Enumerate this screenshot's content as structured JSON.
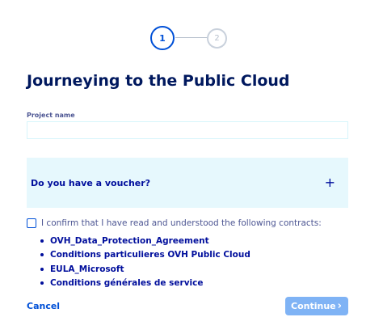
{
  "stepper": {
    "step1": "1",
    "step2": "2"
  },
  "title": "Journeying to the Public Cloud",
  "project": {
    "label": "Project name",
    "value": "",
    "placeholder": ""
  },
  "voucher": {
    "label": "Do you have a voucher?",
    "toggle_icon": "+"
  },
  "confirm": {
    "text": "I confirm that I have read and understood the following contracts:",
    "checked": false,
    "contracts": [
      "OVH_Data_Protection_Agreement",
      "Conditions particulieres OVH Public Cloud",
      "EULA_Microsoft",
      "Conditions générales de service"
    ]
  },
  "actions": {
    "cancel": "Cancel",
    "continue": "Continue",
    "continue_icon": "›"
  },
  "colors": {
    "primary": "#0050d7",
    "text_dark": "#000e9c",
    "voucher_bg": "#e6f8fd",
    "continue_disabled": "#7fb3f5"
  }
}
